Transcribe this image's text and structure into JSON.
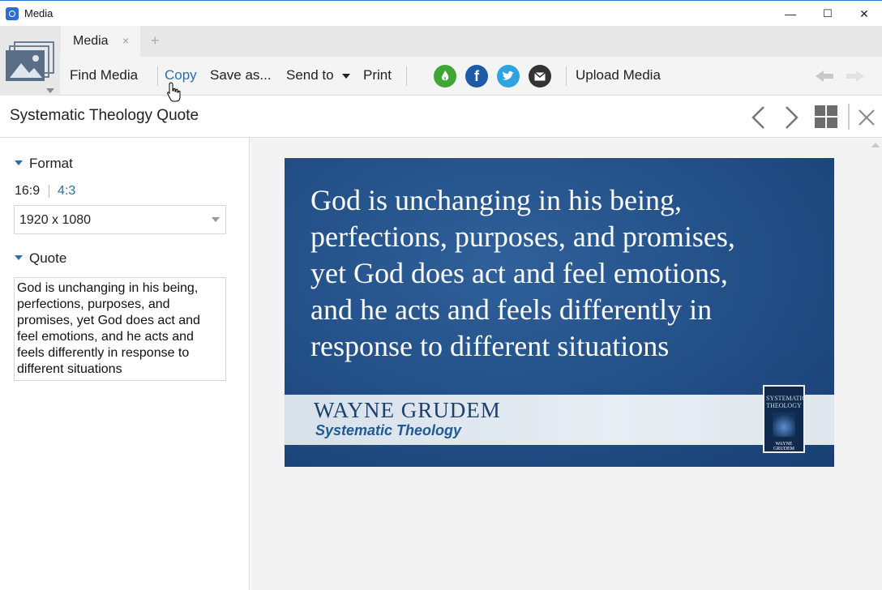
{
  "window": {
    "title": "Media",
    "controls": {
      "minimize": "—",
      "maximize": "☐",
      "close": "✕"
    }
  },
  "tabs": [
    {
      "label": "Media",
      "close": "×"
    }
  ],
  "tab_add": "+",
  "toolbar": {
    "find_media": "Find Media",
    "copy": "Copy",
    "save_as": "Save as...",
    "send_to": "Send to",
    "print": "Print",
    "upload_media": "Upload Media",
    "social_icons": [
      "faithlife-icon",
      "facebook-icon",
      "twitter-icon",
      "email-icon"
    ]
  },
  "header": {
    "title": "Systematic Theology Quote"
  },
  "sidebar": {
    "format": {
      "heading": "Format",
      "ratios": [
        "16:9",
        "4:3"
      ],
      "resolution": "1920 x 1080"
    },
    "quote": {
      "heading": "Quote",
      "text": "God is unchanging in his being, perfections, purposes, and promises, yet God does act and feel emotions, and he acts and feels differently in response to different situations"
    }
  },
  "slide": {
    "quote_lines": [
      "God is unchanging in his being,",
      "perfections, purposes, and promises,",
      "yet God does act and feel emotions,",
      "and he acts and feels differently in",
      "response to different situations"
    ],
    "author": "WAYNE GRUDEM",
    "book": "Systematic Theology",
    "cover_title": "SYSTEMATIC THEOLOGY",
    "cover_author": "WAYNE GRUDEM"
  },
  "colors": {
    "accent": "#2a6fa8",
    "faithlife": "#3fa535",
    "facebook": "#1d5aa8",
    "twitter": "#2fa3e0",
    "email": "#333333",
    "slide_bg": "#224e86"
  }
}
